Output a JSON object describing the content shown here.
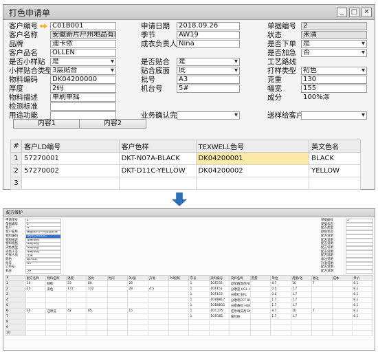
{
  "window": {
    "title": "打色申请单",
    "min": "_",
    "max": "□",
    "close": "✕"
  },
  "form": {
    "col1": [
      {
        "label": "客户编号",
        "value": "C01B001",
        "arrow": true,
        "gray": false,
        "select": false
      },
      {
        "label": "客户名称",
        "value": "安徽新片户州地品有限",
        "arrow": false,
        "gray": true,
        "select": false
      },
      {
        "label": "品牌",
        "value": "迪卡侬",
        "arrow": false,
        "gray": false,
        "select": false
      },
      {
        "label": "客户品名",
        "value": "OLLEN",
        "arrow": false,
        "gray": false,
        "select": false
      },
      {
        "label": "是否小样贴",
        "value": "是",
        "arrow": false,
        "gray": false,
        "select": true
      },
      {
        "label": "小样贴合类型",
        "value": "3层贴合",
        "arrow": false,
        "gray": false,
        "select": true
      },
      {
        "label": "物料编码",
        "value": "DK04200000",
        "arrow": false,
        "gray": false,
        "select": false
      },
      {
        "label": "厚度",
        "value": "2码",
        "arrow": false,
        "gray": false,
        "select": false
      },
      {
        "label": "物料描述",
        "value": "单刷单摇",
        "arrow": false,
        "gray": false,
        "select": false
      },
      {
        "label": "检测标准",
        "value": "",
        "arrow": false,
        "gray": false,
        "select": false
      },
      {
        "label": "用途功能",
        "value": "",
        "arrow": false,
        "gray": false,
        "select": false
      }
    ],
    "col2": [
      {
        "label": "申请日期",
        "value": "2018.09.26",
        "select": false,
        "row": 0
      },
      {
        "label": "季节",
        "value": "AW19",
        "select": false,
        "row": 1
      },
      {
        "label": "成衣负责人",
        "value": "Nina",
        "select": false,
        "row": 2
      },
      {
        "label": "是否贴合",
        "value": "是",
        "select": true,
        "row": 4
      },
      {
        "label": "贴合底面",
        "value": "底",
        "select": true,
        "row": 5
      },
      {
        "label": "批号",
        "value": "A3",
        "select": false,
        "row": 6
      },
      {
        "label": "机台号",
        "value": "5#",
        "select": false,
        "row": 7
      },
      {
        "label": "业务确认完",
        "value": "",
        "select": true,
        "row": 10
      }
    ],
    "col3": [
      {
        "label": "单据编号",
        "value": "2",
        "select": false,
        "gray": true,
        "noborder": false,
        "row": 0
      },
      {
        "label": "状态",
        "value": "未清",
        "select": false,
        "gray": true,
        "noborder": false,
        "row": 1
      },
      {
        "label": "是否下单",
        "value": "是",
        "select": true,
        "gray": false,
        "noborder": false,
        "row": 2
      },
      {
        "label": "是否加急",
        "value": "否",
        "select": true,
        "gray": false,
        "noborder": false,
        "row": 3
      },
      {
        "label": "工艺路线",
        "value": "",
        "select": false,
        "gray": false,
        "noborder": true,
        "row": 4
      },
      {
        "label": "打样类型",
        "value": "初色",
        "select": true,
        "gray": false,
        "noborder": false,
        "row": 5
      },
      {
        "label": "克重",
        "value": "130",
        "select": false,
        "gray": false,
        "noborder": false,
        "row": 6
      },
      {
        "label": "幅宽",
        "value": "155",
        "select": false,
        "gray": false,
        "noborder": false,
        "row": 7
      },
      {
        "label": "成分",
        "value": "100%涤",
        "select": false,
        "gray": false,
        "noborder": true,
        "row": 8
      },
      {
        "label": "送样给客户",
        "value": "",
        "select": true,
        "gray": false,
        "noborder": false,
        "row": 10
      }
    ]
  },
  "tabs": [
    "内容1",
    "内容2"
  ],
  "grid": {
    "headers": [
      "#",
      "客户LD编号",
      "客户色样",
      "TEXWELL色号",
      "英文色名"
    ],
    "rows": [
      {
        "n": "1",
        "ld": "57270001",
        "sample": "DKT-N07A-BLACK",
        "tex": "DK04200001",
        "en": "BLACK"
      },
      {
        "n": "2",
        "ld": "57270002",
        "sample": "DKT-D11C-YELLOW",
        "tex": "DK04200002",
        "en": "YELLOW"
      },
      {
        "n": "3",
        "ld": "",
        "sample": "",
        "tex": "",
        "en": ""
      }
    ]
  },
  "sub": {
    "title": "配方维护",
    "left": [
      {
        "label": "申请单号",
        "value": "2"
      },
      {
        "label": "单据编号",
        "value": "1"
      },
      {
        "label": "客户",
        "value": "A"
      },
      {
        "label": "客户名称",
        "value": "安徽新片户州地品有限"
      },
      {
        "label": "物料编码",
        "value": "DK04200001"
      },
      {
        "label": "物料描述",
        "value": "单刷单摇"
      },
      {
        "label": "物料规格",
        "value": "单刷单摇"
      },
      {
        "label": "染色类型",
        "value": "单刷单摇"
      },
      {
        "label": "染色工艺",
        "value": "单刷单摇"
      },
      {
        "label": "打样人员",
        "value": "王复"
      },
      {
        "label": "颜色",
        "value": "BLACK"
      },
      {
        "label": "批号",
        "value": "A3"
      },
      {
        "label": "订单号",
        "value": ""
      },
      {
        "label": "机台",
        "value": "5#"
      }
    ],
    "right": [
      {
        "label": "单据编号",
        "value": "2"
      },
      {
        "label": "单据状态",
        "value": ""
      },
      {
        "label": "配方类型",
        "value": ""
      },
      {
        "label": "颜色状态",
        "value": ""
      },
      {
        "label": "配方说明",
        "value": ""
      },
      {
        "label": "配方说明",
        "value": ""
      },
      {
        "label": "配方说明",
        "value": ""
      },
      {
        "label": "配方说明",
        "value": ""
      },
      {
        "label": "配方说明",
        "value": ""
      },
      {
        "label": "配方说明",
        "value": ""
      },
      {
        "label": "备注说明",
        "value": ""
      },
      {
        "label": "升温说明",
        "value": ""
      },
      {
        "label": "配方说明",
        "value": ""
      },
      {
        "label": "配方说明",
        "value": ""
      }
    ],
    "headers": [
      "#",
      "配方名称",
      "物料名称",
      "温度",
      "浴比",
      "时间",
      "PH值",
      "升温",
      "PH控制",
      "序号",
      "染料编号",
      "染料名称",
      "用量",
      "单位",
      "用量/浴",
      "备注",
      "成本",
      "单价"
    ],
    "rows": [
      [
        "1",
        "10",
        "精练",
        "33",
        "80",
        "",
        "28",
        "",
        "",
        "1",
        "1OF232",
        "退浆精炼剂FR",
        "",
        "8.7",
        "10",
        "7",
        "",
        "8.1"
      ],
      [
        "2",
        "20",
        "染色",
        "172",
        "132",
        "",
        "28",
        "4.5",
        "",
        "1",
        "1OF151",
        "分散蓝 HGL Hi",
        "",
        "0.5",
        "1.7",
        "",
        "",
        "8.1"
      ],
      [
        "3",
        "",
        "",
        "",
        "",
        "",
        "",
        "",
        "",
        "1",
        "1OF153",
        "分散红玉FL",
        "",
        "0.5",
        "1.7",
        "",
        "",
        "8.1"
      ],
      [
        "4",
        "",
        "",
        "",
        "",
        "",
        "",
        "",
        "",
        "1",
        "1OB8817",
        "分散黑ECT 8F-B bx",
        "",
        "1.7",
        "1.7",
        "",
        "",
        "8.1"
      ],
      [
        "5",
        "",
        "",
        "",
        "",
        "",
        "",
        "",
        "",
        "1",
        "1OB8B11",
        "分散黄棕 HWC",
        "",
        "1.7",
        "1.7",
        "",
        "",
        "8.1"
      ],
      [
        "6",
        "30",
        "还原洗",
        "42",
        "85",
        "",
        "15",
        "",
        "",
        "1",
        "1OC175",
        "还原清洗剂 BS",
        "",
        "8.7",
        "10",
        "7",
        "",
        "8.1"
      ],
      [
        "7",
        "",
        "",
        "",
        "",
        "",
        "",
        "",
        "",
        "1",
        "1OR181",
        "保险粉",
        "",
        "1.7",
        "1.7",
        "",
        "",
        "8.1"
      ],
      [
        "8",
        "",
        "",
        "",
        "",
        "",
        "",
        "",
        "",
        "",
        "",
        "",
        "",
        "",
        "",
        "",
        "",
        ""
      ],
      [
        "9",
        "",
        "",
        "",
        "",
        "",
        "",
        "",
        "",
        "",
        "",
        "",
        "",
        "",
        "",
        "",
        "",
        ""
      ],
      [
        "10",
        "",
        "",
        "",
        "",
        "",
        "",
        "",
        "",
        "",
        "",
        "",
        "",
        "",
        "",
        "",
        "",
        ""
      ]
    ]
  }
}
